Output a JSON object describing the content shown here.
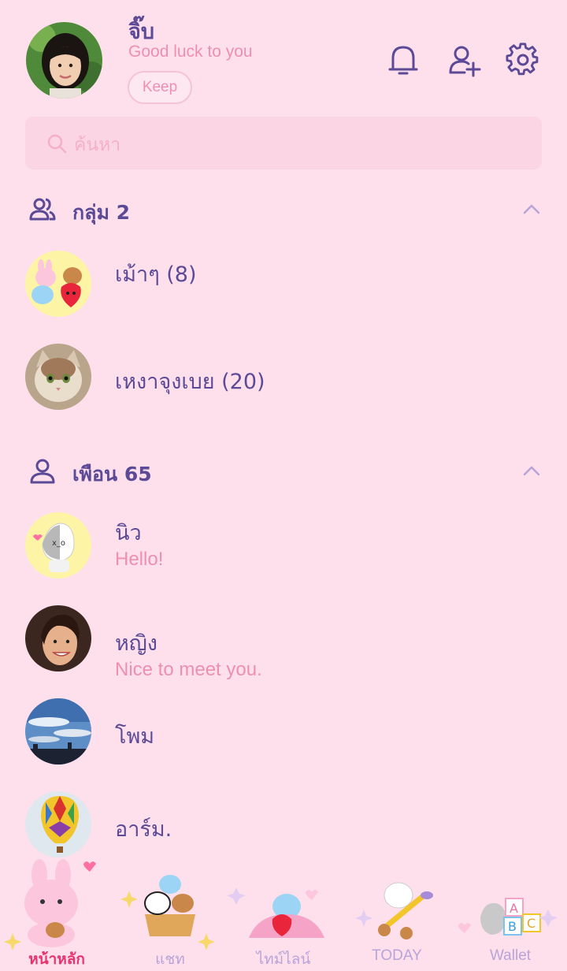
{
  "profile": {
    "name": "จิ๊บ",
    "status": "Good luck to you",
    "keep_label": "Keep"
  },
  "header_icons": [
    "bell-icon",
    "add-friend-icon",
    "settings-icon"
  ],
  "search": {
    "placeholder": "ค้นหา"
  },
  "groups": {
    "title": "กลุ่ม 2",
    "items": [
      {
        "name": "เม้าๆ (8)"
      },
      {
        "name": "เหงาจุงเบย (20)"
      }
    ]
  },
  "friends": {
    "title": "เพือน 65",
    "items": [
      {
        "name": "นิว",
        "status": "Hello!"
      },
      {
        "name": "หญิง",
        "status": "Nice to meet you."
      },
      {
        "name": "โพม",
        "status": ""
      },
      {
        "name": "อาร์ม.",
        "status": ""
      }
    ]
  },
  "tabs": [
    {
      "label": "หน้าหลัก",
      "active": true
    },
    {
      "label": "แชท",
      "active": false
    },
    {
      "label": "ไทม์ไลน์",
      "active": false
    },
    {
      "label": "TODAY",
      "active": false
    },
    {
      "label": "Wallet",
      "active": false
    }
  ],
  "colors": {
    "background": "#fde0ec",
    "primary_text": "#5c4a96",
    "status_text": "#ee8fb0",
    "active_tab": "#e8336f",
    "inactive_tab": "#b9a4d8"
  }
}
